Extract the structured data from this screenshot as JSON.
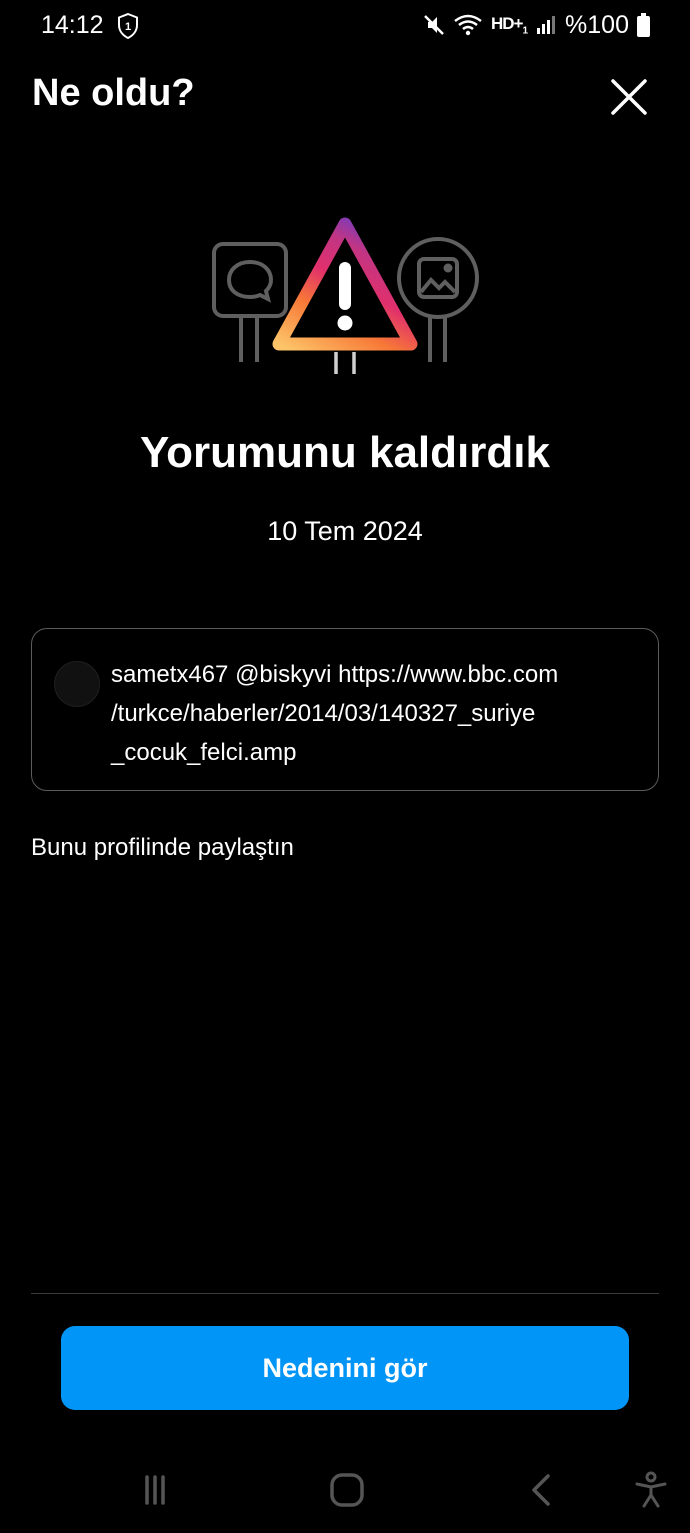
{
  "status_bar": {
    "time": "14:12",
    "network_label": "HD+",
    "network_sub": "1",
    "battery": "%100"
  },
  "header": {
    "title": "Ne oldu?"
  },
  "main": {
    "title": "Yorumunu kaldırdık",
    "date": "10 Tem 2024"
  },
  "comment": {
    "lines": [
      "sametx467 @biskyvi https://www.bbc.com",
      "/turkce/haberler/2014/03/140327_suriye",
      "_cocuk_felci.amp"
    ]
  },
  "shared_note": "Bunu profilinde paylaştın",
  "action": {
    "button_label": "Nedenini gör"
  },
  "colors": {
    "background": "#000000",
    "button": "#0095f6",
    "card_border": "#5c5c5c"
  },
  "icons": {
    "close": "close-icon",
    "warning": "warning-triangle-icon",
    "nav_recent": "recent-apps-icon",
    "nav_home": "home-icon",
    "nav_back": "back-icon",
    "nav_accessibility": "accessibility-icon"
  }
}
